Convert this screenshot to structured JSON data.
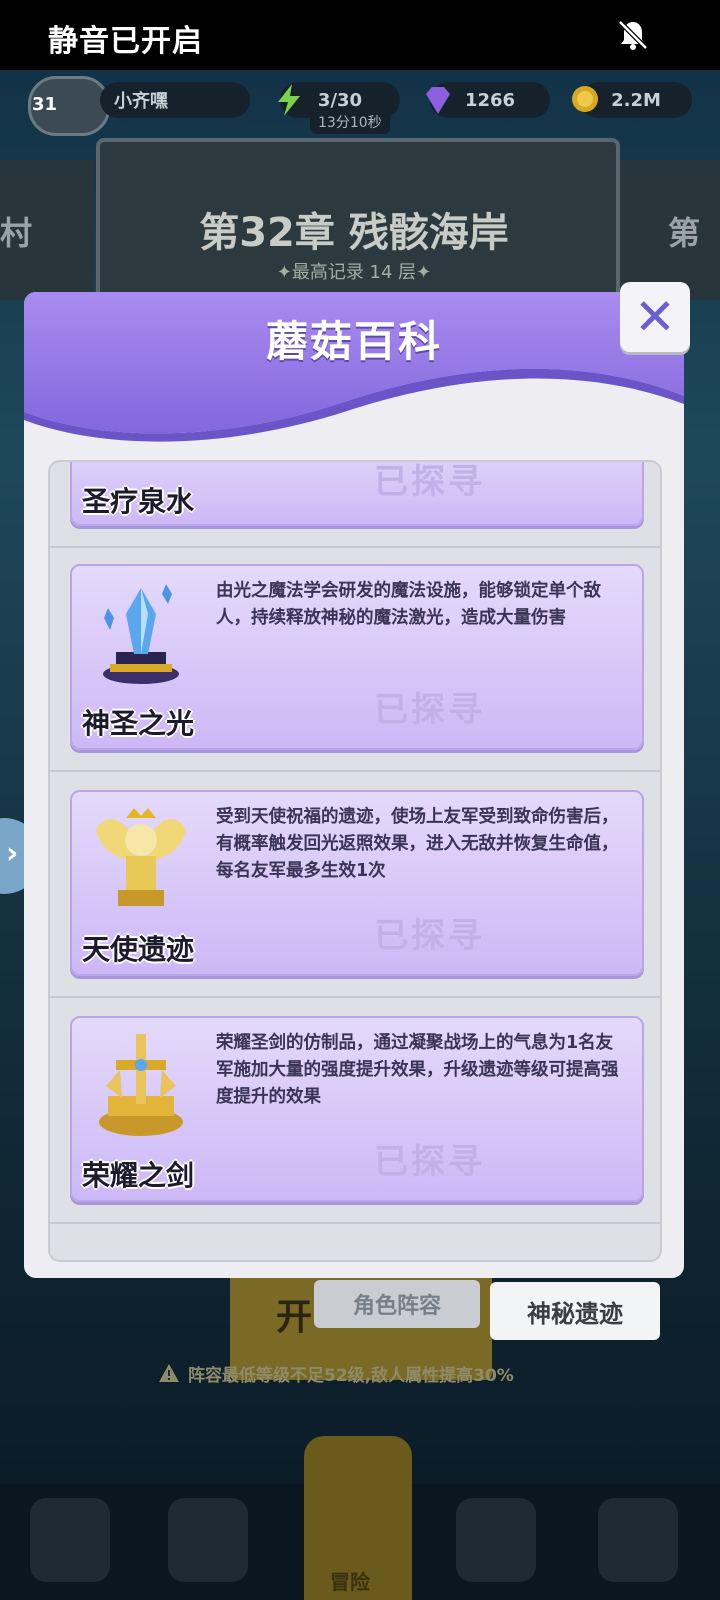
{
  "status_bar": {
    "text": "静音已开启",
    "icon": "bell-muted-icon"
  },
  "player": {
    "level": "31",
    "name": "小齐嘿"
  },
  "resources": {
    "energy": "3/30",
    "energy_timer": "13分10秒",
    "gems": "1266",
    "gold": "2.2M"
  },
  "chapter": {
    "prev_label": "村",
    "next_label": "第",
    "title": "第32章 残骸海岸",
    "record": "✦最高记录 14 层✦"
  },
  "background": {
    "start_partial": "开",
    "tab_roster": "角色阵容",
    "tab_relic": "神秘遗迹",
    "warning": "阵容最低等级不足52级,敌人属性提高30%",
    "nav_adventure": "冒险"
  },
  "dialog": {
    "title": "蘑菇百科",
    "close_icon": "close-icon",
    "entries": [
      {
        "name": "圣疗泉水",
        "desc": "",
        "status": "已探寻"
      },
      {
        "name": "神圣之光",
        "desc": "由光之魔法学会研发的魔法设施，能够锁定单个敌人，持续释放神秘的魔法激光，造成大量伤害",
        "status": "已探寻"
      },
      {
        "name": "天使遗迹",
        "desc": "受到天使祝福的遗迹，使场上友军受到致命伤害后，有概率触发回光返照效果，进入无敌并恢复生命值，每名友军最多生效1次",
        "status": "已探寻"
      },
      {
        "name": "荣耀之剑",
        "desc": "荣耀圣剑的仿制品，通过凝聚战场上的气息为1名友军施加大量的强度提升效果，升级遗迹等级可提高强度提升的效果",
        "status": "已探寻"
      }
    ]
  },
  "colors": {
    "accent_purple": "#8a6fe0",
    "card_bg": "#d8c8f8",
    "close_x": "#6b5fd0"
  }
}
